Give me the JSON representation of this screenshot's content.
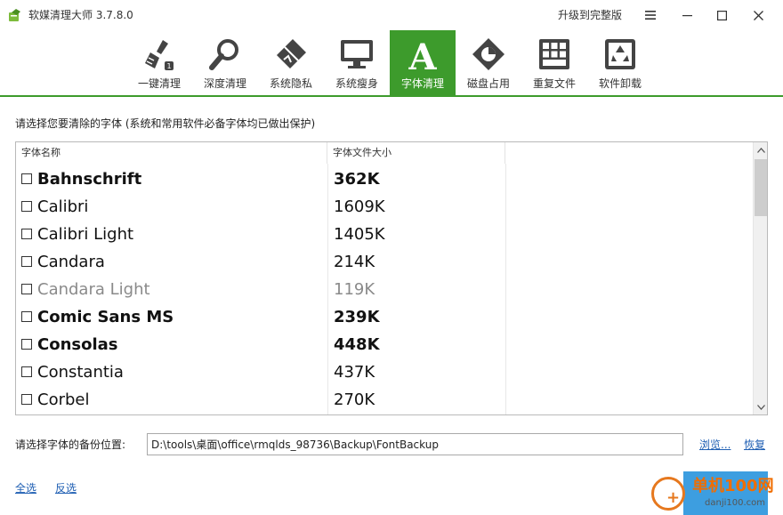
{
  "window": {
    "title": "软媒清理大师 3.7.8.0",
    "upgrade_label": "升级到完整版",
    "accent": "#3d9b2c"
  },
  "toolbar": {
    "items": [
      {
        "label": "一键清理",
        "icon": "broom-icon"
      },
      {
        "label": "深度清理",
        "icon": "magnifier-icon"
      },
      {
        "label": "系统隐私",
        "icon": "eraser-icon"
      },
      {
        "label": "系统瘦身",
        "icon": "monitor-icon"
      },
      {
        "label": "字体清理",
        "icon": "font-a-icon",
        "active": true
      },
      {
        "label": "磁盘占用",
        "icon": "disk-pie-icon"
      },
      {
        "label": "重复文件",
        "icon": "duplicate-grid-icon"
      },
      {
        "label": "软件卸载",
        "icon": "recycle-icon"
      }
    ]
  },
  "main": {
    "instruction": "请选择您要清除的字体 (系统和常用软件必备字体均已做出保护)",
    "columns": {
      "name": "字体名称",
      "size": "字体文件大小"
    },
    "fonts": [
      {
        "name": "Bahnschrift",
        "size": "362K",
        "checked": false
      },
      {
        "name": "Calibri",
        "size": "1609K",
        "checked": false
      },
      {
        "name": "Calibri Light",
        "size": "1405K",
        "checked": false
      },
      {
        "name": "Candara",
        "size": "214K",
        "checked": false
      },
      {
        "name": "Candara Light",
        "size": "119K",
        "checked": false
      },
      {
        "name": "Comic Sans MS",
        "size": "239K",
        "checked": false
      },
      {
        "name": "Consolas",
        "size": "448K",
        "checked": false
      },
      {
        "name": "Constantia",
        "size": "437K",
        "checked": false
      },
      {
        "name": "Corbel",
        "size": "270K",
        "checked": false
      }
    ]
  },
  "backup": {
    "label": "请选择字体的备份位置:",
    "path": "D:\\tools\\桌面\\office\\rmqlds_98736\\Backup\\FontBackup",
    "browse": "浏览...",
    "restore": "恢复"
  },
  "footer": {
    "select_all": "全选",
    "invert": "反选"
  },
  "watermark": {
    "text": "单机100网",
    "url": "danji100.com"
  }
}
